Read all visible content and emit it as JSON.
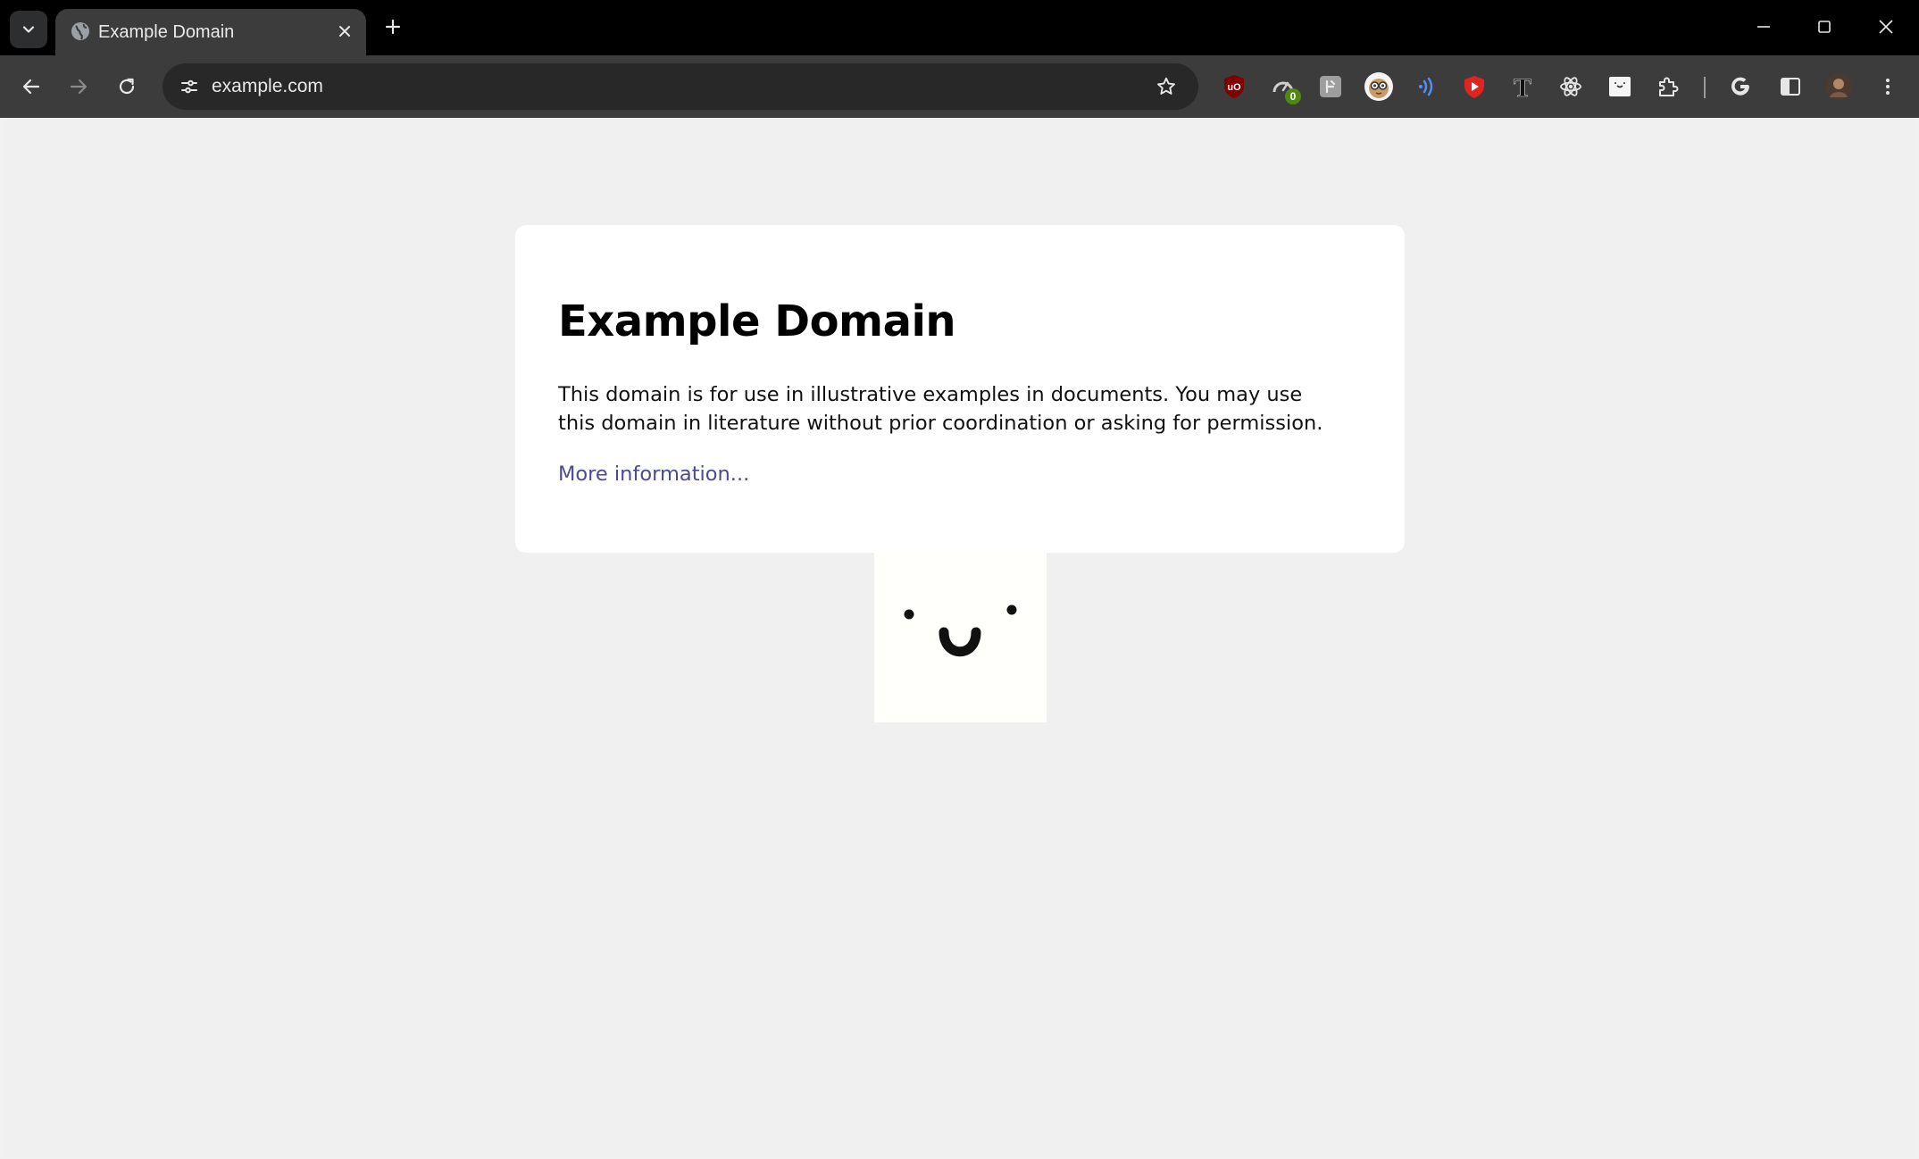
{
  "browser": {
    "tab": {
      "title": "Example Domain"
    },
    "toolbar": {
      "url": "example.com"
    },
    "extensions": [
      {
        "name": "ublock-origin-icon",
        "label": "uO"
      },
      {
        "name": "speedometer-extension-icon",
        "badge": "0"
      },
      {
        "name": "gray-extension-icon"
      },
      {
        "name": "owl-avatar-extension-icon"
      },
      {
        "name": "sound-waves-extension-icon"
      },
      {
        "name": "red-shield-extension-icon"
      },
      {
        "name": "font-t-extension-icon",
        "label": "T"
      },
      {
        "name": "react-atom-extension-icon"
      },
      {
        "name": "white-card-extension-icon"
      },
      {
        "name": "puzzle-extensions-icon"
      },
      {
        "name": "google-g-icon",
        "label": "G"
      },
      {
        "name": "side-panel-icon"
      },
      {
        "name": "profile-avatar-icon"
      },
      {
        "name": "more-menu-icon"
      }
    ],
    "colors": {
      "tabstrip_bg": "#000000",
      "toolbar_bg": "#3c3c3c",
      "omnibox_bg": "#282828",
      "page_bg": "#f0f0f1",
      "link": "#4a4a96"
    }
  },
  "page": {
    "heading": "Example Domain",
    "description": "This domain is for use in illustrative examples in documents. You may use this domain in literature without prior coordination or asking for permission.",
    "link_text": "More information..."
  }
}
